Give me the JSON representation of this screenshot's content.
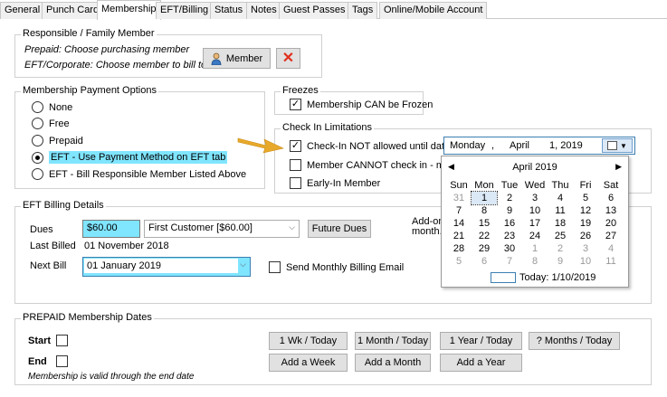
{
  "tabs": [
    "General",
    "Punch Card",
    "Membership",
    "EFT/Billing",
    "Status",
    "Notes",
    "Guest Passes",
    "Tags",
    "Online/Mobile Account"
  ],
  "responsible": {
    "title": "Responsible / Family Member",
    "prepaid_hint": "Prepaid:  Choose purchasing member",
    "eft_hint": "EFT/Corporate: Choose member to bill to",
    "member_button": "Member"
  },
  "payment_options": {
    "title": "Membership Payment Options",
    "options": [
      "None",
      "Free",
      "Prepaid",
      "EFT - Use Payment Method on EFT tab",
      "EFT - Bill Responsible Member Listed Above"
    ],
    "selected_index": 3
  },
  "freezes": {
    "title": "Freezes",
    "can_be_frozen_label": "Membership CAN be Frozen",
    "can_be_frozen": true
  },
  "checkin": {
    "title": "Check In Limitations",
    "not_allowed_label": "Check-In NOT allowed until date",
    "not_allowed": true,
    "cannot_checkin_label": "Member CANNOT check in - mem",
    "early_in_label": "Early-In Member",
    "date_day": "Monday",
    "date_comma": ",",
    "date_month": "April",
    "date_rest": "1, 2019"
  },
  "calendar": {
    "title": "April 2019",
    "prev": "◀",
    "next": "▶",
    "weekdays": [
      "Sun",
      "Mon",
      "Tue",
      "Wed",
      "Thu",
      "Fri",
      "Sat"
    ],
    "weeks": [
      [
        "31",
        "1",
        "2",
        "3",
        "4",
        "5",
        "6"
      ],
      [
        "7",
        "8",
        "9",
        "10",
        "11",
        "12",
        "13"
      ],
      [
        "14",
        "15",
        "16",
        "17",
        "18",
        "19",
        "20"
      ],
      [
        "21",
        "22",
        "23",
        "24",
        "25",
        "26",
        "27"
      ],
      [
        "28",
        "29",
        "30",
        "1",
        "2",
        "3",
        "4"
      ],
      [
        "5",
        "6",
        "7",
        "8",
        "9",
        "10",
        "11"
      ]
    ],
    "today_label": "Today: 1/10/2019"
  },
  "eft_billing": {
    "title": "EFT Billing Details",
    "dues_label": "Dues",
    "dues_value": "$60.00",
    "dues_combo": "First Customer [$60.00]",
    "future_dues_button": "Future Dues",
    "addon_text_1": "Add-on",
    "addon_text_2": "month.",
    "last_billed_label": "Last Billed",
    "last_billed_value": "01 November 2018",
    "next_bill_label": "Next Bill",
    "next_bill_value": "01 January 2019",
    "send_email_label": "Send Monthly Billing Email"
  },
  "prepaid": {
    "title": "PREPAID Membership Dates",
    "start_label": "Start",
    "end_label": "End",
    "valid_note": "Membership is valid through the end date",
    "buttons_row1": [
      "1 Wk / Today",
      "1 Month / Today",
      "1 Year / Today",
      "? Months / Today"
    ],
    "buttons_row2": [
      "Add a Week",
      "Add a Month",
      "Add a Year"
    ]
  },
  "colors": {
    "highlight": "#80e5ff",
    "arrow": "#e8a92a",
    "close_x": "#e0301e"
  }
}
